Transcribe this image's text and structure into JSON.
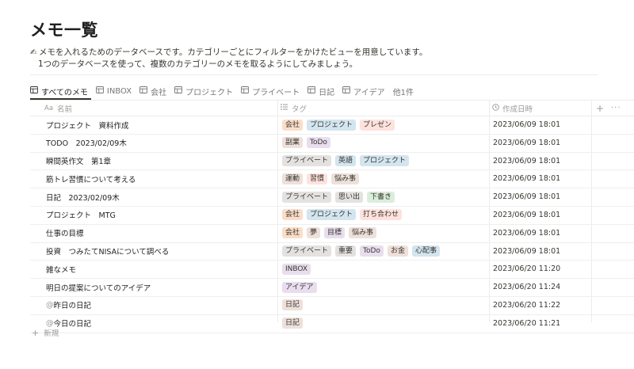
{
  "page": {
    "title": "メモ一覧",
    "desc1_icon": "✍",
    "desc1": "メモを入れるためのデータベースです。カテゴリーごとにフィルターをかけたビューを用意しています。",
    "desc2": "1つのデータベースを使って、複数のカテゴリーのメモを取るようにしてみましょう。"
  },
  "tabs": [
    {
      "label": "すべてのメモ",
      "icon": "table-icon",
      "active": true
    },
    {
      "label": "INBOX",
      "icon": "table-icon"
    },
    {
      "label": "会社",
      "icon": "table-icon"
    },
    {
      "label": "プロジェクト",
      "icon": "table-icon"
    },
    {
      "label": "プライベート",
      "icon": "table-icon"
    },
    {
      "label": "日記",
      "icon": "table-icon"
    },
    {
      "label": "アイデア",
      "icon": "table-icon"
    },
    {
      "label": "他1件"
    }
  ],
  "columns": {
    "name": "名前",
    "tags": "タグ",
    "date": "作成日時",
    "name_icon": "Aa",
    "add": "+",
    "more": "···"
  },
  "tag_colors": {
    "gray": "#e3e2e0",
    "brown": "#eee0da",
    "orange": "#fadec9",
    "yellow": "#fdecc8",
    "green": "#dbeddb",
    "blue": "#d3e5ef",
    "purple": "#e8deee",
    "pink": "#f5e0e9",
    "red": "#ffe2dd"
  },
  "rows": [
    {
      "name": "プロジェクト　資料作成",
      "tags": [
        [
          "会社",
          "orange"
        ],
        [
          "プロジェクト",
          "blue"
        ],
        [
          "プレゼン",
          "red"
        ]
      ],
      "date": "2023/06/09 18:01"
    },
    {
      "name": "TODO　2023/02/09木",
      "tags": [
        [
          "副業",
          "brown"
        ],
        [
          "ToDo",
          "purple"
        ]
      ],
      "date": "2023/06/09 18:01"
    },
    {
      "name": "瞬間英作文　第1章",
      "tags": [
        [
          "プライベート",
          "gray"
        ],
        [
          "英語",
          "blue"
        ],
        [
          "プロジェクト",
          "blue"
        ]
      ],
      "date": "2023/06/09 18:01"
    },
    {
      "name": "筋トレ習慣について考える",
      "tags": [
        [
          "運動",
          "brown"
        ],
        [
          "習慣",
          "red"
        ],
        [
          "悩み事",
          "brown"
        ]
      ],
      "date": "2023/06/09 18:01"
    },
    {
      "name": "日記　2023/02/09木",
      "tags": [
        [
          "プライベート",
          "gray"
        ],
        [
          "思い出",
          "gray"
        ],
        [
          "下書き",
          "green"
        ]
      ],
      "date": "2023/06/09 18:01"
    },
    {
      "name": "プロジェクト　MTG",
      "tags": [
        [
          "会社",
          "orange"
        ],
        [
          "プロジェクト",
          "blue"
        ],
        [
          "打ち合わせ",
          "red"
        ]
      ],
      "date": "2023/06/09 18:01"
    },
    {
      "name": "仕事の目標",
      "tags": [
        [
          "会社",
          "orange"
        ],
        [
          "夢",
          "brown"
        ],
        [
          "目標",
          "purple"
        ],
        [
          "悩み事",
          "brown"
        ]
      ],
      "date": "2023/06/09 18:01"
    },
    {
      "name": "投資　つみたてNISAについて調べる",
      "tags": [
        [
          "プライベート",
          "gray"
        ],
        [
          "重要",
          "gray"
        ],
        [
          "ToDo",
          "purple"
        ],
        [
          "お金",
          "brown"
        ],
        [
          "心配事",
          "blue"
        ]
      ],
      "date": "2023/06/09 18:01"
    },
    {
      "name": "雑なメモ",
      "tags": [
        [
          "INBOX",
          "purple"
        ]
      ],
      "date": "2023/06/20 11:20"
    },
    {
      "name": "明日の提案についてのアイデア",
      "tags": [
        [
          "アイデア",
          "purple"
        ]
      ],
      "date": "2023/06/20 11:24"
    },
    {
      "name": "昨日の日記",
      "at": "@",
      "tags": [
        [
          "日記",
          "brown"
        ]
      ],
      "date": "2023/06/20 11:22"
    },
    {
      "name": "今日の日記",
      "at": "@",
      "tags": [
        [
          "日記",
          "brown"
        ]
      ],
      "date": "2023/06/20 11:21"
    }
  ],
  "new_row_label": "新規"
}
